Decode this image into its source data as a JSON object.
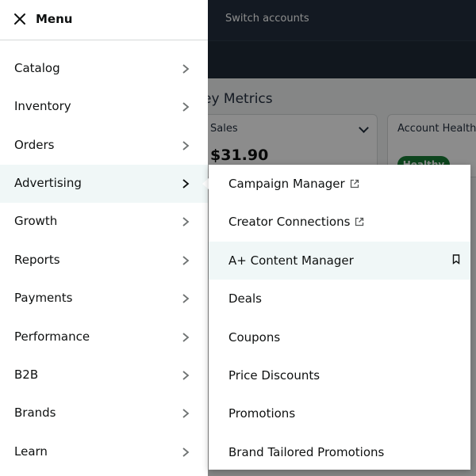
{
  "background": {
    "switch_accounts": "Switch accounts",
    "section_title": "ey Metrics",
    "sales_card": {
      "label": "Sales",
      "value": "$31.90"
    },
    "health_card": {
      "label": "Account Health",
      "badge": "Healthy"
    }
  },
  "menu": {
    "title": "Menu",
    "items": [
      {
        "label": "Catalog"
      },
      {
        "label": "Inventory"
      },
      {
        "label": "Orders"
      },
      {
        "label": "Advertising"
      },
      {
        "label": "Growth"
      },
      {
        "label": "Reports"
      },
      {
        "label": "Payments"
      },
      {
        "label": "Performance"
      },
      {
        "label": "B2B"
      },
      {
        "label": "Brands"
      },
      {
        "label": "Learn"
      }
    ]
  },
  "submenu": {
    "items": [
      {
        "label": "Campaign Manager",
        "icon": "external-link-icon"
      },
      {
        "label": "Creator Connections",
        "icon": "external-link-icon"
      },
      {
        "label": "A+ Content Manager",
        "icon": "bookmark-icon"
      },
      {
        "label": "Deals"
      },
      {
        "label": "Coupons"
      },
      {
        "label": "Price Discounts"
      },
      {
        "label": "Promotions"
      },
      {
        "label": "Brand Tailored Promotions"
      }
    ]
  },
  "colors": {
    "topbar": "#232f3e",
    "active_row": "#f0f7f7",
    "text": "#0f1111"
  }
}
